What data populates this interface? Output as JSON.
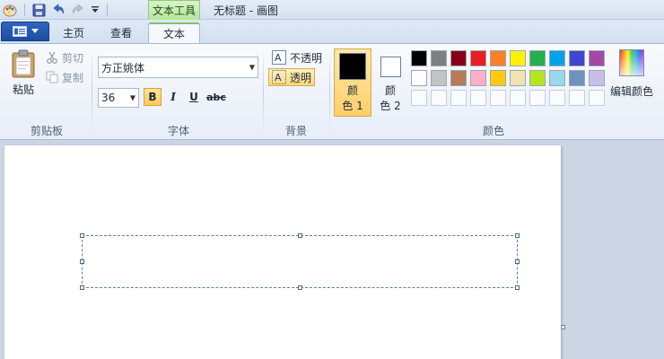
{
  "window": {
    "title": "无标题 - 画图",
    "context_tab_title": "文本工具"
  },
  "tabs": [
    {
      "label": "主页"
    },
    {
      "label": "查看"
    },
    {
      "label": "文本"
    }
  ],
  "groups": {
    "clipboard": {
      "label": "剪贴板",
      "paste": "粘贴",
      "cut": "剪切",
      "copy": "复制"
    },
    "font": {
      "label": "字体",
      "font_name": "方正姚体",
      "font_size": "36",
      "bold": "B",
      "italic": "I",
      "underline": "U",
      "strikethrough": "abc"
    },
    "background": {
      "label": "背景",
      "opaque": "不透明",
      "transparent": "透明"
    },
    "colors": {
      "label": "颜色",
      "color1_line1": "颜",
      "color1_line2": "色 1",
      "color2_line1": "颜",
      "color2_line2": "色 2",
      "edit_colors": "编辑颜色"
    }
  },
  "palette": {
    "color1": "#000000",
    "color2": "#ffffff",
    "row1": [
      "#000000",
      "#7f7f7f",
      "#880015",
      "#ed1c24",
      "#ff7f27",
      "#fff200",
      "#22b14c",
      "#00a2e8",
      "#3f48cc",
      "#a349a4"
    ],
    "row2": [
      "#ffffff",
      "#c3c3c3",
      "#b97a57",
      "#ffaec9",
      "#ffc90e",
      "#efe4b0",
      "#b5e61d",
      "#99d9ea",
      "#7092be",
      "#c8bfe7"
    ]
  }
}
